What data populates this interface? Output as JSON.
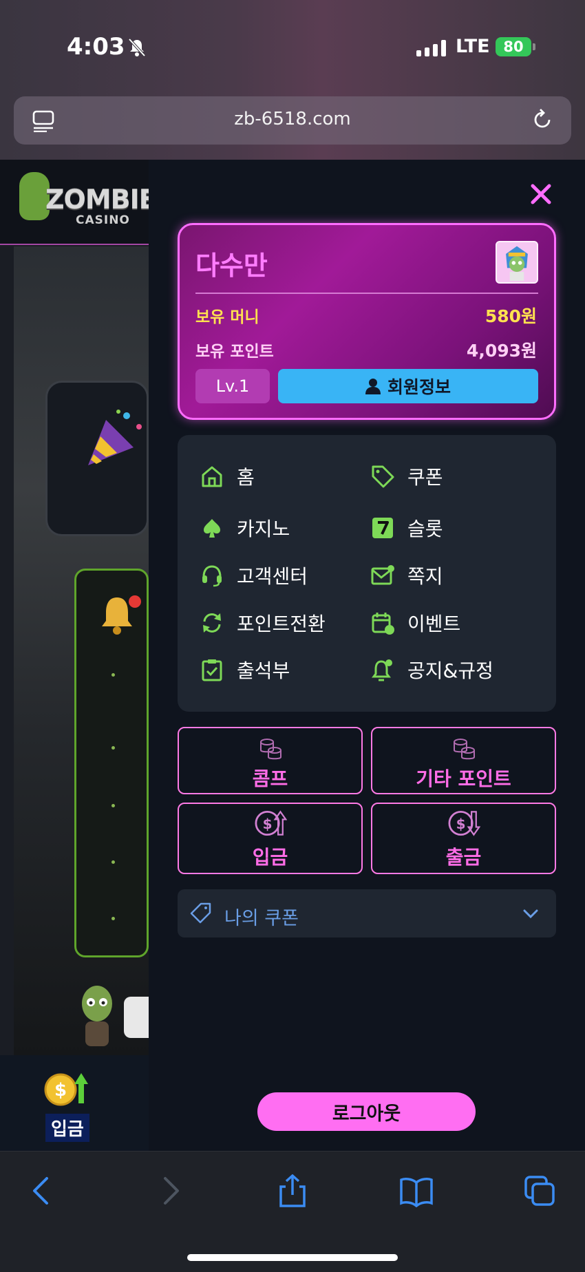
{
  "status_bar": {
    "time": "4:03",
    "network": "LTE",
    "battery": "80"
  },
  "browser": {
    "url": "zb-6518.com"
  },
  "site": {
    "logo_main": "ZOMBIE",
    "logo_sub": "CASINO",
    "bottom_deposit_label": "입금"
  },
  "drawer": {
    "profile": {
      "name": "다수만",
      "money_label": "보유 머니",
      "money_value": "580원",
      "points_label": "보유 포인트",
      "points_value": "4,093원",
      "level": "Lv.1",
      "member_info_label": "회원정보"
    },
    "menu": [
      {
        "label": "홈",
        "icon": "home-icon"
      },
      {
        "label": "쿠폰",
        "icon": "tag-icon"
      },
      {
        "label": "카지노",
        "icon": "spade-icon"
      },
      {
        "label": "슬롯",
        "icon": "slot-seven-icon"
      },
      {
        "label": "고객센터",
        "icon": "headset-icon"
      },
      {
        "label": "쪽지",
        "icon": "mail-icon"
      },
      {
        "label": "포인트전환",
        "icon": "refresh-icon"
      },
      {
        "label": "이벤트",
        "icon": "calendar-icon"
      },
      {
        "label": "출석부",
        "icon": "clipboard-check-icon"
      },
      {
        "label": "공지&규정",
        "icon": "bell-icon"
      }
    ],
    "actions": {
      "comp": "콤프",
      "other_points": "기타 포인트",
      "deposit": "입금",
      "withdraw": "출금"
    },
    "my_coupon": "나의 쿠폰",
    "logout": "로그아웃"
  },
  "colors": {
    "accent_pink": "#ff6dff",
    "menu_icon_green": "#7ed957",
    "member_button_blue": "#39b4f5",
    "money_yellow": "#ffe14f"
  }
}
